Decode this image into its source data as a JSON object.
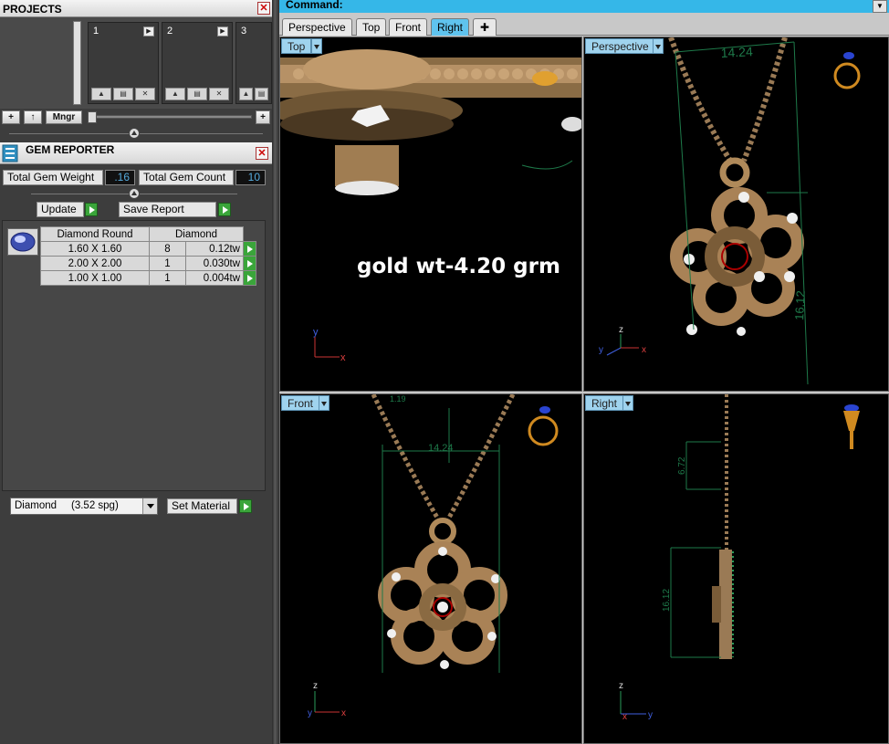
{
  "projects": {
    "title": "PROJECTS",
    "thumbs": [
      {
        "num": "1"
      },
      {
        "num": "2"
      },
      {
        "num": "3"
      }
    ],
    "manager_label": "Mngr"
  },
  "gem_reporter": {
    "title": "GEM REPORTER",
    "total_weight_label": "Total Gem Weight",
    "total_weight_value": ".16",
    "total_count_label": "Total Gem Count",
    "total_count_value": "10",
    "update_label": "Update",
    "save_report_label": "Save Report",
    "table": {
      "headers": [
        "Diamond Round",
        "Diamond"
      ],
      "rows": [
        {
          "size": "1.60 X 1.60",
          "count": "8",
          "weight": "0.12tw"
        },
        {
          "size": "2.00 X 2.00",
          "count": "1",
          "weight": "0.030tw"
        },
        {
          "size": "1.00 X 1.00",
          "count": "1",
          "weight": "0.004tw"
        }
      ]
    },
    "material_select": "Diamond     (3.52 spg)",
    "set_material_label": "Set Material"
  },
  "command_bar": {
    "label": "Command:"
  },
  "view_tabs": [
    "Perspective",
    "Top",
    "Front",
    "Right"
  ],
  "view_tabs_active": "Right",
  "viewports": {
    "top": {
      "label": "Top",
      "overlay": "gold wt-4.20 grm"
    },
    "perspective": {
      "label": "Perspective",
      "dim_width": "14.24",
      "dim_height": "16.12"
    },
    "front": {
      "label": "Front",
      "dim_width": "14.24",
      "dim_small": "1.19"
    },
    "right": {
      "label": "Right",
      "dim_top": "6.72",
      "dim_height": "16.12"
    }
  },
  "axes": {
    "x": "x",
    "y": "y",
    "z": "z"
  },
  "colors": {
    "accent": "#35b7e8",
    "tab_active": "#5fc3ee",
    "go_button": "#3aa53a",
    "gold": "#b08a5a",
    "dimension_lines": "#1e7a4a"
  }
}
